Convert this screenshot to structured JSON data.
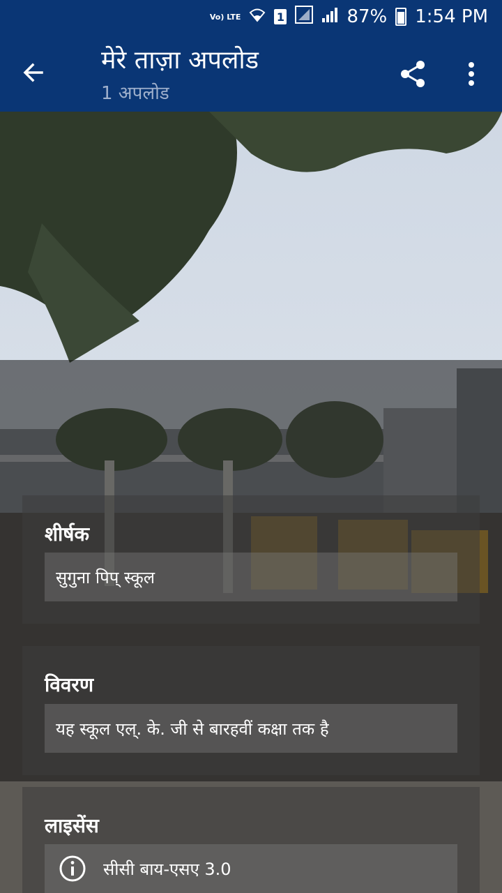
{
  "status_bar": {
    "volte": "Vo) LTE",
    "sim": "1",
    "battery": "87%",
    "time": "1:54 PM"
  },
  "app_bar": {
    "title": "मेरे ताज़ा अपलोड",
    "subtitle": "1 अपलोड",
    "icons": [
      "back-arrow-icon",
      "share-icon",
      "more-vert-icon"
    ]
  },
  "upload": {
    "title_label": "शीर्षक",
    "title_value": "सुगुना पिप् स्कूल",
    "description_label": "विवरण",
    "description_value": "यह स्कूल एल्. के. जी से बारहवीं कक्षा तक है",
    "license_label": "लाइसेंस",
    "license_value": "सीसी बाय-एसए 3.0"
  }
}
